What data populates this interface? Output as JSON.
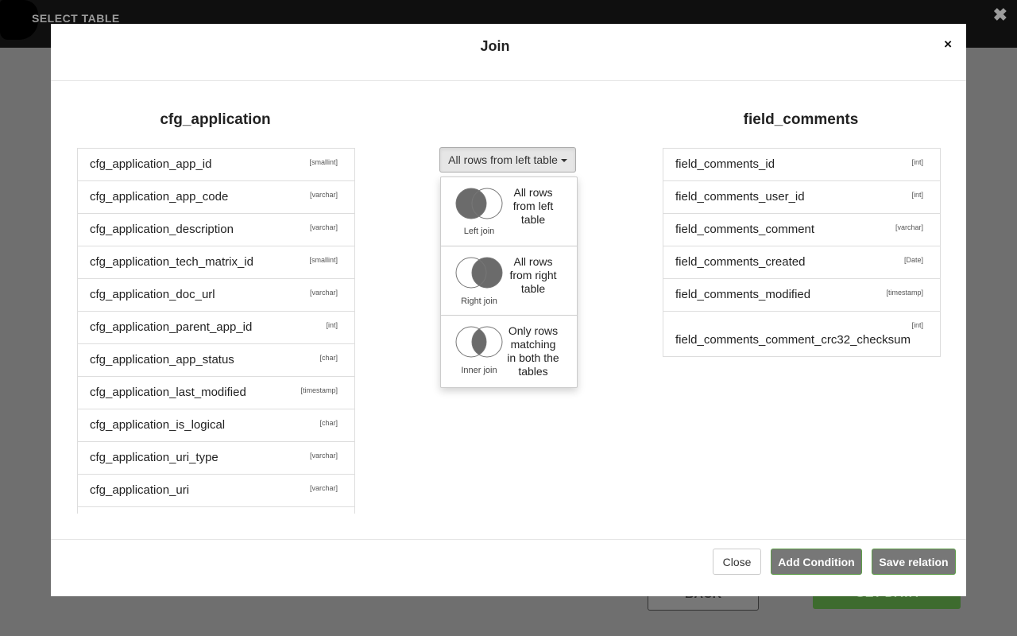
{
  "background": {
    "header_title": "SELECT TABLE",
    "back_label": "BACK",
    "get_data_label": "GET DATA"
  },
  "modal": {
    "title": "Join",
    "close_symbol": "×"
  },
  "left_table": {
    "name": "cfg_application",
    "fields": [
      {
        "name": "cfg_application_app_id",
        "type": "[smallint]"
      },
      {
        "name": "cfg_application_app_code",
        "type": "[varchar]"
      },
      {
        "name": "cfg_application_description",
        "type": "[varchar]"
      },
      {
        "name": "cfg_application_tech_matrix_id",
        "type": "[smallint]"
      },
      {
        "name": "cfg_application_doc_url",
        "type": "[varchar]"
      },
      {
        "name": "cfg_application_parent_app_id",
        "type": "[int]"
      },
      {
        "name": "cfg_application_app_status",
        "type": "[char]"
      },
      {
        "name": "cfg_application_last_modified",
        "type": "[timestamp]"
      },
      {
        "name": "cfg_application_is_logical",
        "type": "[char]"
      },
      {
        "name": "cfg_application_uri_type",
        "type": "[varchar]"
      },
      {
        "name": "cfg_application_uri",
        "type": "[varchar]"
      }
    ]
  },
  "right_table": {
    "name": "field_comments",
    "fields": [
      {
        "name": "field_comments_id",
        "type": "[int]"
      },
      {
        "name": "field_comments_user_id",
        "type": "[int]"
      },
      {
        "name": "field_comments_comment",
        "type": "[varchar]"
      },
      {
        "name": "field_comments_created",
        "type": "[Date]"
      },
      {
        "name": "field_comments_modified",
        "type": "[timestamp]"
      },
      {
        "name": "field_comments_comment_crc32_checksum",
        "type": "[int]"
      }
    ]
  },
  "join": {
    "selected": "All rows from left table",
    "options": [
      {
        "name": "Left join",
        "desc_lines": [
          "All rows",
          "from left",
          "table"
        ]
      },
      {
        "name": "Right join",
        "desc_lines": [
          "All rows",
          "from right",
          "table"
        ]
      },
      {
        "name": "Inner join",
        "desc_lines": [
          "Only rows",
          "matching",
          "in both the",
          "tables"
        ]
      }
    ]
  },
  "footer": {
    "close_label": "Close",
    "add_condition_label": "Add Condition",
    "save_relation_label": "Save relation"
  },
  "colors": {
    "venn_fill": "#6b6b6b",
    "accent_border": "#5f9e4a",
    "button_gray": "#777777"
  }
}
